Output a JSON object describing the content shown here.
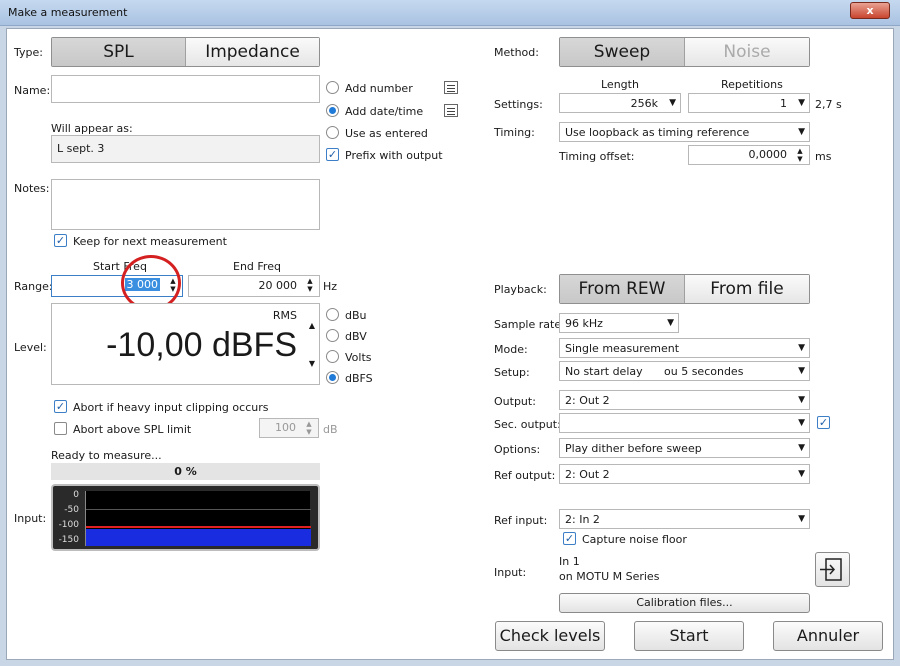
{
  "window": {
    "title": "Make a measurement",
    "close_label": "x"
  },
  "type": {
    "label": "Type:",
    "options": [
      "SPL",
      "Impedance"
    ],
    "selected": "SPL"
  },
  "name": {
    "label": "Name:",
    "value": "",
    "add_number": "Add number",
    "add_date_time": "Add date/time",
    "use_as_entered": "Use as entered",
    "prefix_with_output": "Prefix with output"
  },
  "appear": {
    "label": "Will appear as:",
    "value": "L sept. 3"
  },
  "notes": {
    "label": "Notes:",
    "value": "",
    "keep_label": "Keep for next measurement"
  },
  "range": {
    "label": "Range:",
    "start_label": "Start Freq",
    "start_value": "3 000",
    "end_label": "End Freq",
    "end_value": "20 000",
    "unit": "Hz"
  },
  "level": {
    "label": "Level:",
    "rms_label": "RMS",
    "value": "-10,00 dBFS",
    "units": [
      "dBu",
      "dBV",
      "Volts",
      "dBFS"
    ],
    "selected_unit": "dBFS"
  },
  "abort": {
    "heavy_clipping": "Abort if heavy input clipping occurs",
    "above_spl": "Abort above SPL limit",
    "spl_limit": "100",
    "spl_unit": "dB"
  },
  "status": {
    "text": "Ready to measure...",
    "progress_text": "0 %",
    "progress": 0
  },
  "input_meter": {
    "label": "Input:",
    "ticks": [
      "0",
      "-50",
      "-100",
      "-150"
    ]
  },
  "method": {
    "label": "Method:",
    "options": [
      "Sweep",
      "Noise"
    ],
    "selected": "Sweep"
  },
  "settings": {
    "label": "Settings:",
    "length_label": "Length",
    "length_value": "256k",
    "repetitions_label": "Repetitions",
    "repetitions_value": "1",
    "duration": "2,7 s"
  },
  "timing": {
    "label": "Timing:",
    "value": "Use loopback as timing reference",
    "offset_label": "Timing offset:",
    "offset_value": "0,0000",
    "offset_unit": "ms"
  },
  "playback": {
    "label": "Playback:",
    "options": [
      "From REW",
      "From file"
    ],
    "selected": "From REW"
  },
  "sample_rate": {
    "label": "Sample rate:",
    "value": "96 kHz"
  },
  "mode": {
    "label": "Mode:",
    "value": "Single measurement"
  },
  "setup": {
    "label": "Setup:",
    "value": "No start delay",
    "annotation": "ou  5 secondes"
  },
  "output": {
    "label": "Output:",
    "value": "2: Out 2"
  },
  "sec_output": {
    "label": "Sec. output:",
    "value": ""
  },
  "options": {
    "label": "Options:",
    "value": "Play dither before sweep"
  },
  "ref_output": {
    "label": "Ref output:",
    "value": "2: Out 2"
  },
  "ref_input": {
    "label": "Ref input:",
    "value": "2: In 2",
    "capture_label": "Capture noise floor"
  },
  "input_device": {
    "label": "Input:",
    "line1": "In 1",
    "line2": "on MOTU M Series"
  },
  "buttons": {
    "calibration": "Calibration files...",
    "check_levels": "Check levels",
    "start": "Start",
    "cancel": "Annuler"
  },
  "colors": {
    "accent": "#1f7ad8",
    "annotation_circle": "#d42020",
    "meter_fill": "#1a2ce0",
    "meter_trace": "#e02020"
  }
}
